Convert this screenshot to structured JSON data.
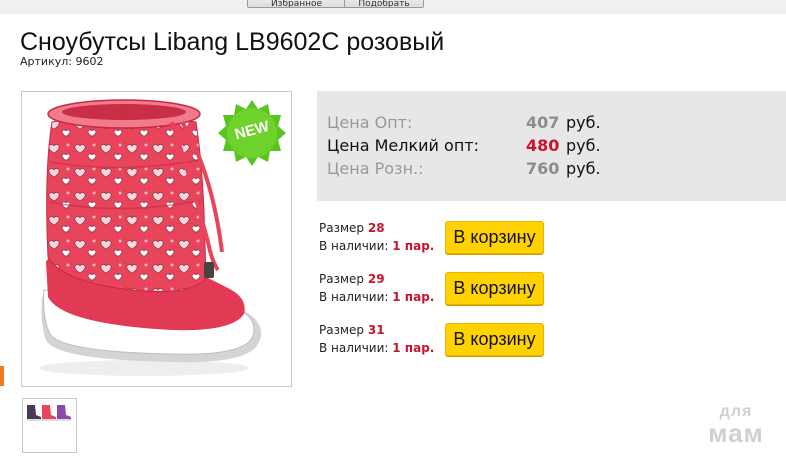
{
  "top_buttons": [
    "Избранное",
    "Подобрать"
  ],
  "product": {
    "title": "Сноубутсы Libang LB9602C розовый",
    "sku_label": "Артикул:",
    "sku_value": "9602",
    "badge": "NEW"
  },
  "prices": [
    {
      "label": "Цена Опт:",
      "value": "407",
      "currency": "руб.",
      "highlight": false
    },
    {
      "label": "Цена Мелкий опт:",
      "value": "480",
      "currency": "руб.",
      "highlight": true
    },
    {
      "label": "Цена Розн.:",
      "value": "760",
      "currency": "руб.",
      "highlight": false
    }
  ],
  "sizes": [
    {
      "size_label": "Размер",
      "size": "28",
      "stock_label": "В наличии:",
      "stock": "1 пар.",
      "cart_label": "В корзину"
    },
    {
      "size_label": "Размер",
      "size": "29",
      "stock_label": "В наличии:",
      "stock": "1 пар.",
      "cart_label": "В корзину"
    },
    {
      "size_label": "Размер",
      "size": "31",
      "stock_label": "В наличии:",
      "stock": "1 пар.",
      "cart_label": "В корзину"
    }
  ],
  "watermark": {
    "line1": "для",
    "line2": "мам"
  },
  "colors": {
    "accent_red": "#c8152b",
    "cart_yellow": "#ffd200",
    "badge_green": "#58c41e",
    "boot_pink": "#e8445c"
  }
}
